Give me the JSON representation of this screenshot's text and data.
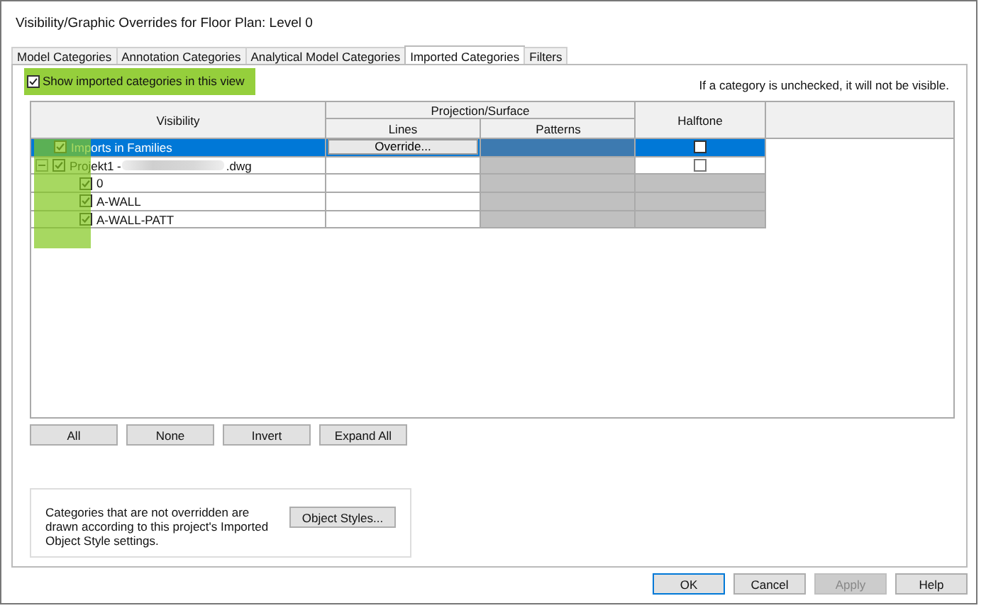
{
  "window": {
    "title": "Visibility/Graphic Overrides for Floor Plan: Level 0"
  },
  "tabs": [
    {
      "label": "Model Categories",
      "selected": false
    },
    {
      "label": "Annotation Categories",
      "selected": false
    },
    {
      "label": "Analytical Model Categories",
      "selected": false
    },
    {
      "label": "Imported Categories",
      "selected": true
    },
    {
      "label": "Filters",
      "selected": false
    }
  ],
  "show_checkbox": {
    "label": "Show imported categories in this view",
    "checked": true
  },
  "hint": "If a category is unchecked, it will not be visible.",
  "table": {
    "headers": {
      "visibility": "Visibility",
      "group": "Projection/Surface",
      "lines": "Lines",
      "patterns": "Patterns",
      "halftone": "Halftone"
    },
    "rows": [
      {
        "name": "Imports in Families",
        "checked": true,
        "selected": true,
        "lines": "Override...",
        "halftone_checked": false
      },
      {
        "name": "Projekt1 - ",
        "suffix": ".dwg",
        "redacted": true,
        "checked": true,
        "selected": false,
        "expanded": true,
        "halftone_checked": false,
        "children": [
          {
            "name": "0",
            "checked": true,
            "selected": false
          },
          {
            "name": "A-WALL",
            "checked": true,
            "selected": false
          },
          {
            "name": "A-WALL-PATT",
            "checked": true,
            "selected": false
          }
        ]
      }
    ]
  },
  "table_buttons": [
    "All",
    "None",
    "Invert",
    "Expand All"
  ],
  "info": {
    "text": "Categories that are not overridden are drawn according to this project's Imported Object Style settings.",
    "button": "Object Styles..."
  },
  "footer_buttons": [
    {
      "label": "OK",
      "disabled": false,
      "default": true
    },
    {
      "label": "Cancel",
      "disabled": false,
      "default": false
    },
    {
      "label": "Apply",
      "disabled": true,
      "default": false
    },
    {
      "label": "Help",
      "disabled": false,
      "default": false
    }
  ]
}
